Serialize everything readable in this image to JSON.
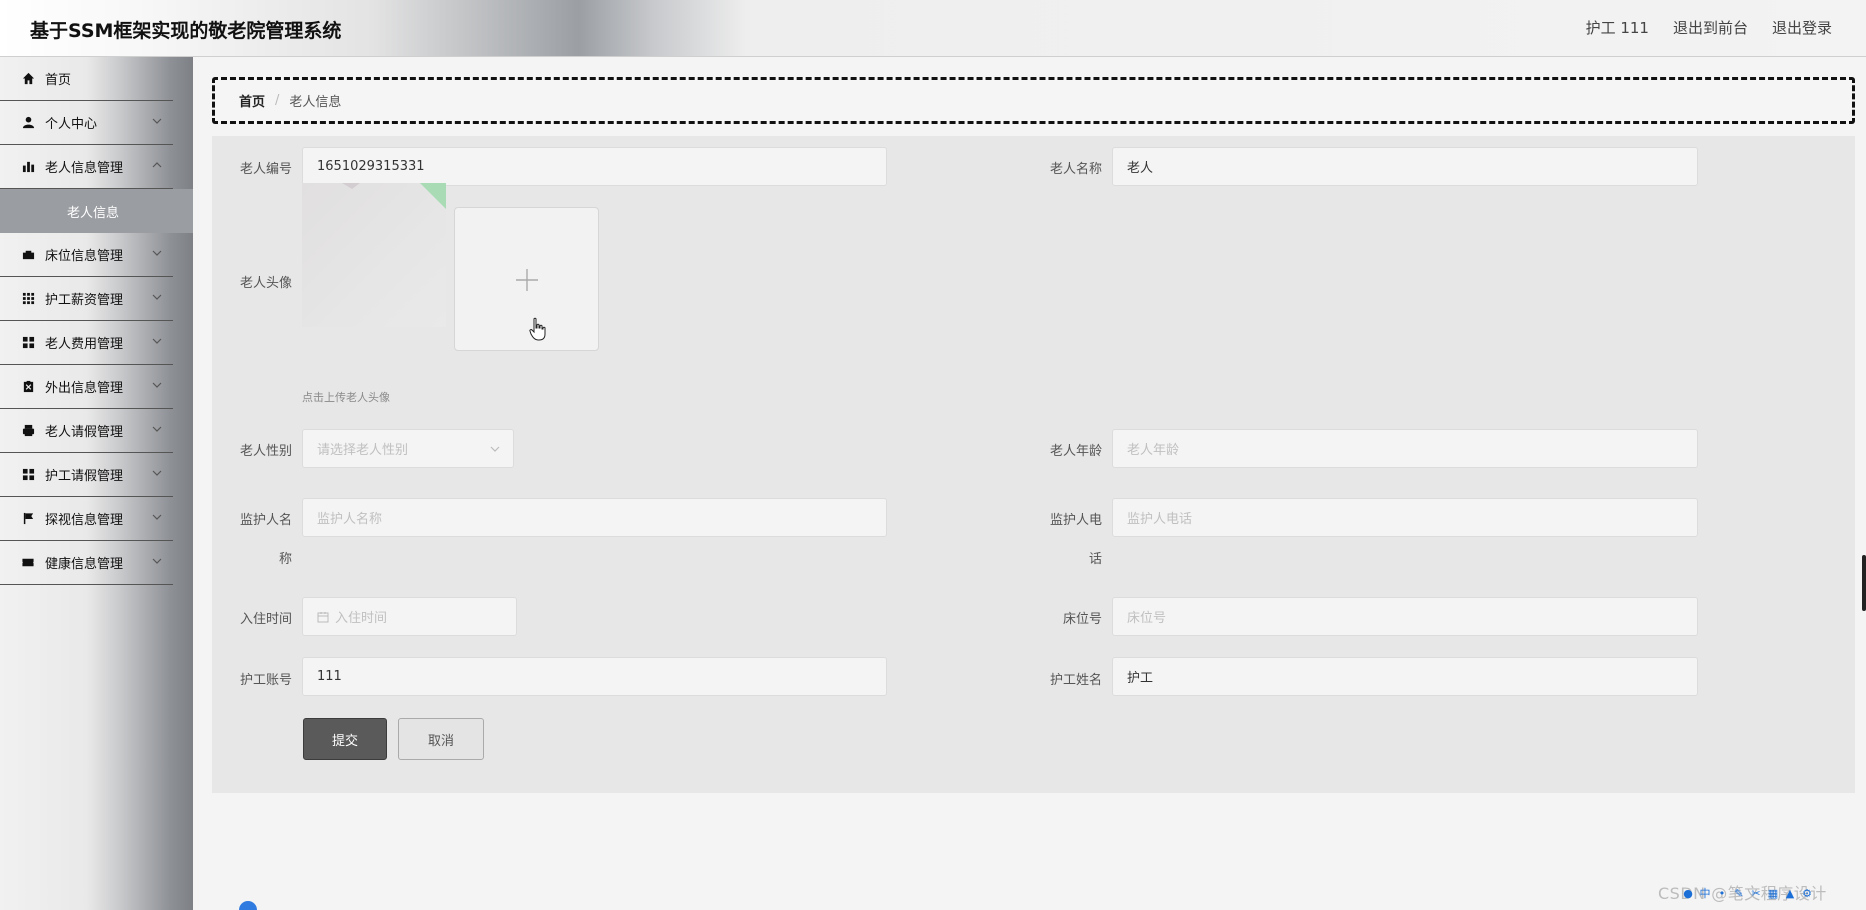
{
  "header": {
    "app_title": "基于SSM框架实现的敬老院管理系统",
    "nav": {
      "user": "护工 111",
      "to_front": "退出到前台",
      "logout": "退出登录"
    }
  },
  "sidebar": {
    "items": [
      {
        "label": "首页",
        "icon": "home-icon"
      },
      {
        "label": "个人中心",
        "icon": "user-icon"
      },
      {
        "label": "老人信息管理",
        "icon": "bar-chart-icon"
      },
      {
        "label": "床位信息管理",
        "icon": "bed-icon"
      },
      {
        "label": "护工薪资管理",
        "icon": "grid-icon"
      },
      {
        "label": "老人费用管理",
        "icon": "apps-icon"
      },
      {
        "label": "外出信息管理",
        "icon": "clipboard-icon"
      },
      {
        "label": "老人请假管理",
        "icon": "printer-icon"
      },
      {
        "label": "护工请假管理",
        "icon": "apps-icon"
      },
      {
        "label": "探视信息管理",
        "icon": "flag-icon"
      },
      {
        "label": "健康信息管理",
        "icon": "ticket-icon"
      }
    ],
    "active_sub": "老人信息"
  },
  "breadcrumb": {
    "home": "首页",
    "separator": "/",
    "current": "老人信息"
  },
  "form": {
    "elder_no": {
      "label": "老人编号",
      "value": "1651029315331"
    },
    "elder_name": {
      "label": "老人名称",
      "value": "老人"
    },
    "avatar": {
      "label": "老人头像",
      "tip": "点击上传老人头像",
      "plus": "+"
    },
    "gender": {
      "label": "老人性别",
      "placeholder": "请选择老人性别"
    },
    "age": {
      "label": "老人年龄",
      "placeholder": "老人年龄"
    },
    "guardian_name": {
      "label_line1": "监护人名",
      "label_line2": "称",
      "placeholder": "监护人名称"
    },
    "guardian_phone": {
      "label_line1": "监护人电",
      "label_line2": "话",
      "placeholder": "监护人电话"
    },
    "checkin_time": {
      "label": "入住时间",
      "placeholder": "入住时间"
    },
    "bed_no": {
      "label": "床位号",
      "placeholder": "床位号"
    },
    "nurse_account": {
      "label": "护工账号",
      "value": "111"
    },
    "nurse_name": {
      "label": "护工姓名",
      "value": "护工"
    },
    "submit": "提交",
    "cancel": "取消"
  },
  "footer": {
    "watermark": "CSDN @笔文程序设计"
  },
  "colors": {
    "primary_button": "#5a5a5a",
    "active_submenu": "#9a9da2"
  }
}
